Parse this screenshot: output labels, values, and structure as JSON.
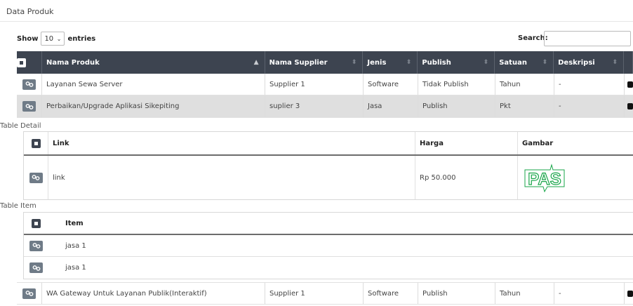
{
  "page_title": "Data Produk",
  "length_menu": {
    "prefix": "Show",
    "value": "10",
    "suffix": "entries"
  },
  "search": {
    "label": "Search:",
    "value": ""
  },
  "columns": [
    "Nama Produk",
    "Nama Supplier",
    "Jenis",
    "Publish",
    "Satuan",
    "Deskripsi"
  ],
  "rows": [
    {
      "nama_produk": "Layanan Sewa Server",
      "nama_supplier": "Supplier 1",
      "jenis": "Software",
      "publish": "Tidak Publish",
      "satuan": "Tahun",
      "deskripsi": "-"
    },
    {
      "nama_produk": "Perbaikan/Upgrade Aplikasi Sikepiting",
      "nama_supplier": "suplier 3",
      "jenis": "Jasa",
      "publish": "Publish",
      "satuan": "Pkt",
      "deskripsi": "-"
    },
    {
      "nama_produk": "WA Gateway Untuk Layanan Publik(Interaktif)",
      "nama_supplier": "Supplier 1",
      "jenis": "Software",
      "publish": "Publish",
      "satuan": "Tahun",
      "deskripsi": "-"
    }
  ],
  "detail": {
    "label": "Table Detail",
    "columns": [
      "Link",
      "Harga",
      "Gambar"
    ],
    "rows": [
      {
        "link": "link",
        "harga": "Rp 50.000",
        "gambar_logo_text": "PAS"
      }
    ]
  },
  "items": {
    "label": "Table Item",
    "column": "Item",
    "rows": [
      "jasa 1",
      "jasa 1"
    ]
  },
  "colors": {
    "header_bg": "#3d4450",
    "button_bg": "#6f7b87",
    "shaded_row": "#dfdfdf",
    "logo_green": "#1aa64a"
  },
  "icons": {
    "row_action": "gears-icon",
    "expand": "plus-square-icon",
    "sort": "sort-icon"
  }
}
